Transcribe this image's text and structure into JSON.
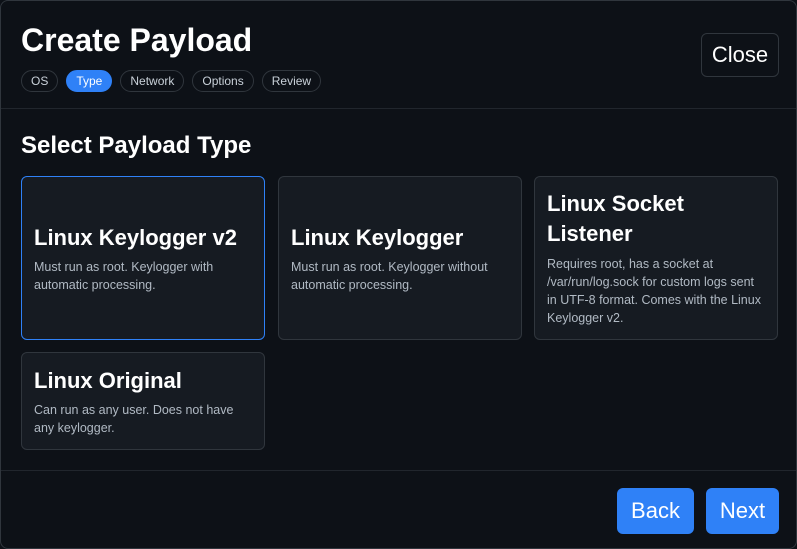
{
  "header": {
    "title": "Create Payload",
    "close_label": "Close",
    "steps": [
      {
        "label": "OS",
        "active": false
      },
      {
        "label": "Type",
        "active": true
      },
      {
        "label": "Network",
        "active": false
      },
      {
        "label": "Options",
        "active": false
      },
      {
        "label": "Review",
        "active": false
      }
    ]
  },
  "main": {
    "section_title": "Select Payload Type",
    "cards": [
      {
        "title": "Linux Keylogger v2",
        "description": "Must run as root. Keylogger with automatic processing.",
        "selected": true
      },
      {
        "title": "Linux Keylogger",
        "description": "Must run as root. Keylogger without automatic processing.",
        "selected": false
      },
      {
        "title": "Linux Socket Listener",
        "description": "Requires root, has a socket at /var/run/log.sock for custom logs sent in UTF-8 format. Comes with the Linux Keylogger v2.",
        "selected": false
      },
      {
        "title": "Linux Original",
        "description": "Can run as any user. Does not have any keylogger.",
        "selected": false
      }
    ]
  },
  "footer": {
    "back_label": "Back",
    "next_label": "Next"
  },
  "colors": {
    "accent": "#2f81f7",
    "background": "#0d1117",
    "card_background": "#161b22",
    "border": "#30363d"
  }
}
